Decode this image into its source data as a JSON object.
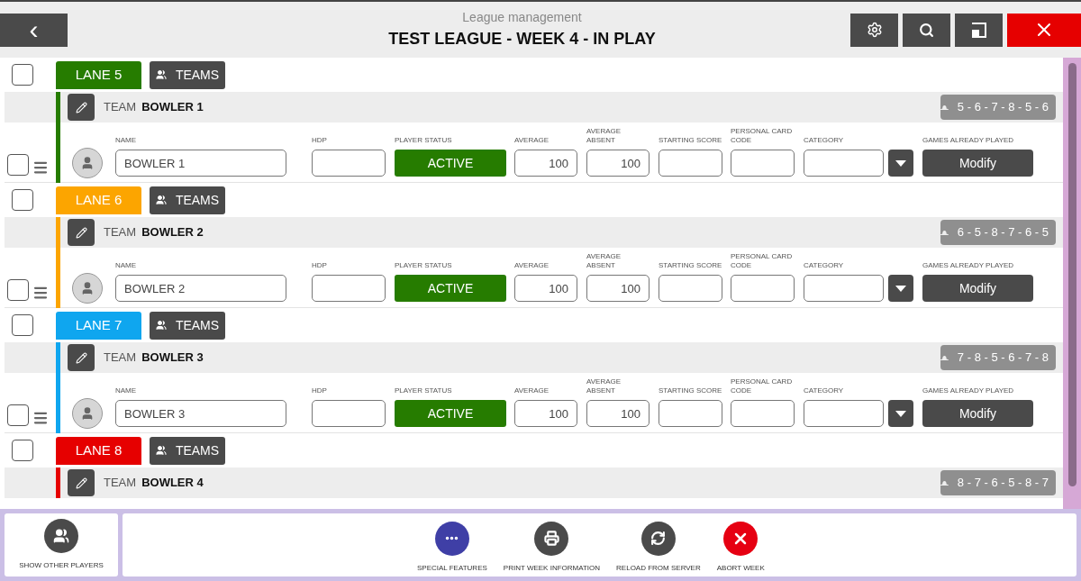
{
  "header": {
    "back_label": "‹",
    "subtitle": "League management",
    "title": "TEST LEAGUE - WEEK 4 - IN PLAY"
  },
  "lanes": [
    {
      "lane": "LANE 5",
      "color": "#267c00",
      "checked": false,
      "teams": "TEAMS",
      "team_prefix": "TEAM",
      "team_name": "BOWLER 1",
      "sequence": "5 - 6 - 7 - 8 - 5 - 6",
      "player": {
        "checked": false,
        "fields": [
          {
            "kind": "input",
            "label": "NAME",
            "value": "BOWLER 1"
          },
          {
            "kind": "input",
            "label": "HDP"
          },
          {
            "kind": "status",
            "label": "PLAYER STATUS",
            "value": "ACTIVE"
          },
          {
            "kind": "number",
            "label": "AVERAGE",
            "value": "100"
          },
          {
            "kind": "number",
            "label": "AVERAGE ABSENT",
            "value": "100"
          },
          {
            "kind": "input",
            "label": "STARTING SCORE"
          },
          {
            "kind": "input",
            "label": "PERSONAL CARD CODE"
          },
          {
            "kind": "select",
            "label": "CATEGORY"
          },
          {
            "kind": "button",
            "label": "GAMES ALREADY PLAYED",
            "value": "Modify"
          }
        ]
      }
    },
    {
      "lane": "LANE 6",
      "color": "#fca500",
      "checked": false,
      "teams": "TEAMS",
      "team_prefix": "TEAM",
      "team_name": "BOWLER 2",
      "sequence": "6 - 5 - 8 - 7 - 6 - 5",
      "player": {
        "checked": false,
        "fields": [
          {
            "kind": "input",
            "label": "NAME",
            "value": "BOWLER 2"
          },
          {
            "kind": "input",
            "label": "HDP"
          },
          {
            "kind": "status",
            "label": "PLAYER STATUS",
            "value": "ACTIVE"
          },
          {
            "kind": "number",
            "label": "AVERAGE",
            "value": "100"
          },
          {
            "kind": "number",
            "label": "AVERAGE ABSENT",
            "value": "100"
          },
          {
            "kind": "input",
            "label": "STARTING SCORE"
          },
          {
            "kind": "input",
            "label": "PERSONAL CARD CODE"
          },
          {
            "kind": "select",
            "label": "CATEGORY"
          },
          {
            "kind": "button",
            "label": "GAMES ALREADY PLAYED",
            "value": "Modify"
          }
        ]
      }
    },
    {
      "lane": "LANE 7",
      "color": "#0fa6ef",
      "checked": false,
      "teams": "TEAMS",
      "team_prefix": "TEAM",
      "team_name": "BOWLER 3",
      "sequence": "7 - 8 - 5 - 6 - 7 - 8",
      "player": {
        "checked": false,
        "fields": [
          {
            "kind": "input",
            "label": "NAME",
            "value": "BOWLER 3"
          },
          {
            "kind": "input",
            "label": "HDP"
          },
          {
            "kind": "status",
            "label": "PLAYER STATUS",
            "value": "ACTIVE"
          },
          {
            "kind": "number",
            "label": "AVERAGE",
            "value": "100"
          },
          {
            "kind": "number",
            "label": "AVERAGE ABSENT",
            "value": "100"
          },
          {
            "kind": "input",
            "label": "STARTING SCORE"
          },
          {
            "kind": "input",
            "label": "PERSONAL CARD CODE"
          },
          {
            "kind": "select",
            "label": "CATEGORY"
          },
          {
            "kind": "button",
            "label": "GAMES ALREADY PLAYED",
            "value": "Modify"
          }
        ]
      }
    },
    {
      "lane": "LANE 8",
      "color": "#e60000",
      "checked": false,
      "teams": "TEAMS",
      "team_prefix": "TEAM",
      "team_name": "BOWLER 4",
      "sequence": "8 - 7 - 6 - 5 - 8 - 7"
    }
  ],
  "footer": {
    "left": {
      "kind": "players",
      "label": "SHOW OTHER PLAYERS"
    },
    "actions": [
      {
        "kind": "more",
        "label": "SPECIAL FEATURES",
        "color": "#3f3fa6"
      },
      {
        "kind": "print",
        "label": "PRINT WEEK INFORMATION",
        "color": "#4a4a4a"
      },
      {
        "kind": "reload",
        "label": "RELOAD FROM SERVER",
        "color": "#4a4a4a"
      },
      {
        "kind": "abort",
        "label": "ABORT WEEK",
        "color": "#e60012"
      }
    ]
  }
}
